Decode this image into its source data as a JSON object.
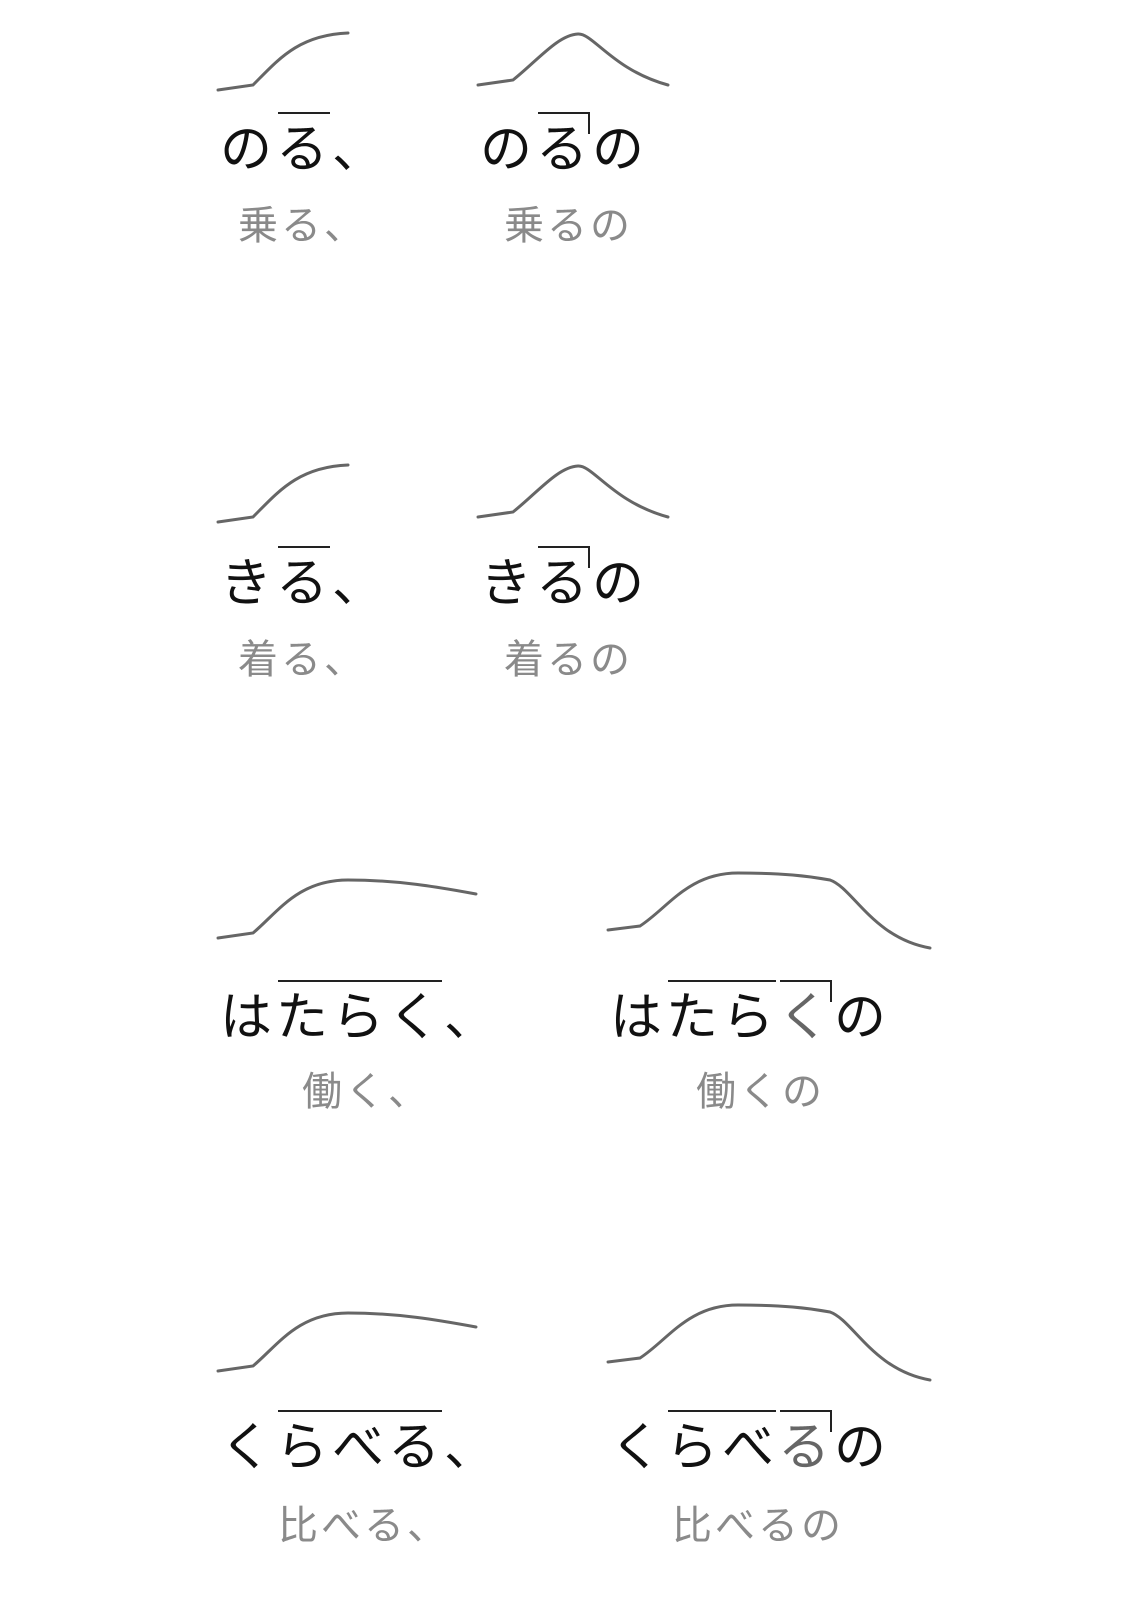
{
  "rows": [
    {
      "plain": {
        "k1": "の",
        "hi": "る",
        "k2": "、",
        "kanji": "乗る、"
      },
      "particle": {
        "k1": "の",
        "hi": "る",
        "k2": "の",
        "kanji": "乗るの"
      }
    },
    {
      "plain": {
        "k1": "き",
        "hi": "る",
        "k2": "、",
        "kanji": "着る、"
      },
      "particle": {
        "k1": "き",
        "hi": "る",
        "k2": "の",
        "kanji": "着るの"
      }
    },
    {
      "plain": {
        "k1": "は",
        "hi": "たらく",
        "k2": "、",
        "kanji": "働く、"
      },
      "particle": {
        "k1": "は",
        "hi1": "たら",
        "hi2": "く",
        "k2": "の",
        "kanji": "働くの"
      }
    },
    {
      "plain": {
        "k1": "く",
        "hi": "らべる",
        "k2": "、",
        "kanji": "比べる、"
      },
      "particle": {
        "k1": "く",
        "hi1": "らべ",
        "hi2": "る",
        "k2": "の",
        "kanji": "比べるの"
      }
    }
  ]
}
